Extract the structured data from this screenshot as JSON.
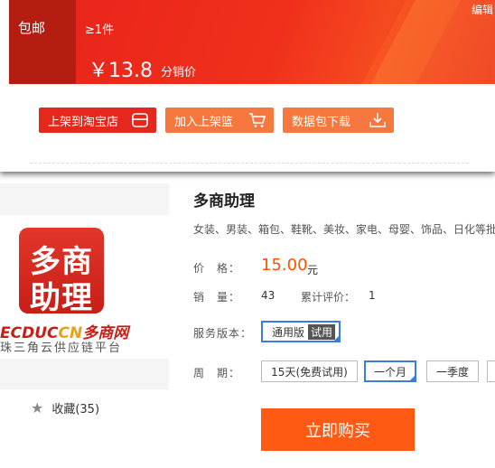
{
  "banner": {
    "shipping": "包邮",
    "min_qty": "≥1件",
    "price": "￥13.8",
    "price_note": "分销价",
    "edit": "编辑"
  },
  "actions": {
    "taobao": "上架到淘宝店",
    "add_shelf": "加入上架篮",
    "download": "数据包下载"
  },
  "sidebar": {
    "logo_line1": "多商",
    "logo_line2": "助理",
    "brand_a": "ECDUC",
    "brand_b": "CN",
    "brand_c": "多商网",
    "brand_sub": "珠三角云供应链平台",
    "favorite": "收藏(35)"
  },
  "product": {
    "title": "多商助理",
    "description": "女装、男装、箱包、鞋靴、美妆、家电、母婴、饰品、日化等批",
    "price_label": "价　格：",
    "price": "15.00",
    "price_unit": "元",
    "sales_label": "销　量：",
    "sales": "43",
    "reviews_label": "累计评价：",
    "reviews": "1",
    "version_label": "服务版本：",
    "version": "通用版",
    "version_badge": "试用",
    "period_label": "周　期：",
    "periods": [
      "15天(免费试用)",
      "一个月",
      "一季度"
    ],
    "buy": "立即购买"
  },
  "colors": {
    "accent": "#ff5000",
    "banner": "#e8221a",
    "select_border": "#3b7ddd"
  }
}
